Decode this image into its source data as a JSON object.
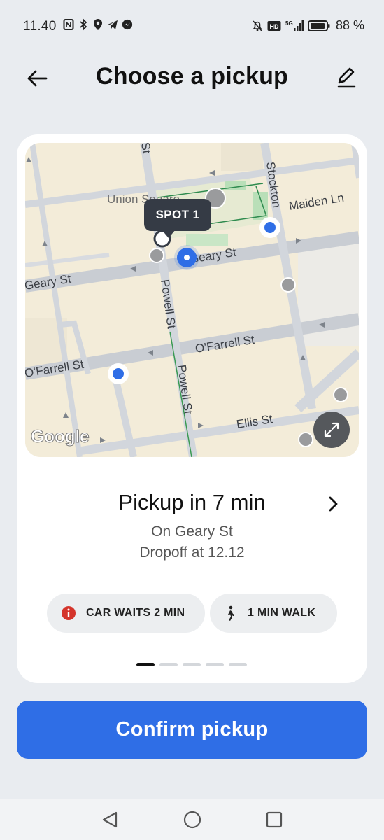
{
  "status_bar": {
    "time": "11.40",
    "battery": "88 %",
    "icons": [
      "nfc-icon",
      "bluetooth-icon",
      "location-icon",
      "telegram-icon",
      "messenger-icon",
      "mute-icon",
      "hd-icon",
      "signal-5g-icon",
      "battery-icon"
    ]
  },
  "header": {
    "title": "Choose a pickup",
    "back_icon": "arrow-left-icon",
    "edit_icon": "pencil-icon"
  },
  "map": {
    "streets": {
      "geary_right": "Geary St",
      "geary_left": "Geary St",
      "ofarrell_right": "O'Farrell St",
      "ofarrell_left": "O'Farrell St",
      "powell_1": "Powell St",
      "powell_2": "Powell St",
      "ellis": "Ellis St",
      "stockton": "Stockton",
      "maiden": "Maiden Ln",
      "st_top": "St",
      "union_square": "Union Square"
    },
    "spot_label": "SPOT 1",
    "attribution": "Google",
    "expand_icon": "expand-icon"
  },
  "pickup": {
    "title": "Pickup in 7 min",
    "street": "On Geary St",
    "dropoff": "Dropoff at 12.12"
  },
  "chips": [
    {
      "label": "CAR WAITS 2 MIN",
      "icon": "info-icon",
      "color": "#d4342b"
    },
    {
      "label": "1 MIN WALK",
      "icon": "walk-icon"
    }
  ],
  "pagination": {
    "total": 5,
    "active": 1
  },
  "confirm_label": "Confirm pickup",
  "accent": "#2f6ee6"
}
